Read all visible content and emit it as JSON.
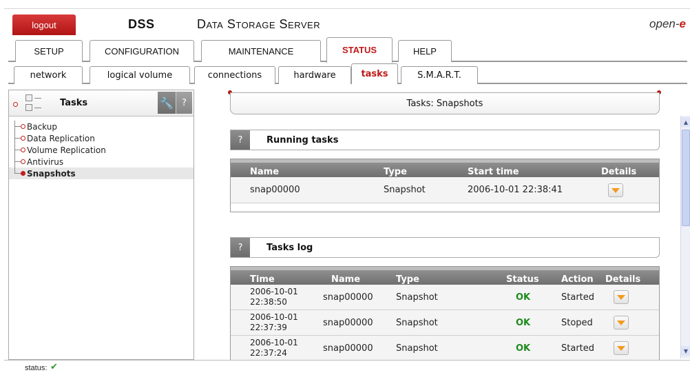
{
  "header": {
    "logout_label": "logout",
    "brand": "DSS",
    "product": "Data Storage Server",
    "vendor_prefix": "open-",
    "vendor_suffix": "e"
  },
  "main_tabs": [
    {
      "label": "SETUP"
    },
    {
      "label": "CONFIGURATION"
    },
    {
      "label": "MAINTENANCE"
    },
    {
      "label": "STATUS"
    },
    {
      "label": "HELP"
    }
  ],
  "sub_tabs": [
    {
      "label": "network"
    },
    {
      "label": "logical volume"
    },
    {
      "label": "connections"
    },
    {
      "label": "hardware"
    },
    {
      "label": "tasks"
    },
    {
      "label": "S.M.A.R.T."
    }
  ],
  "left_panel": {
    "title": "Tasks",
    "help_label": "?",
    "items": [
      {
        "label": "Backup"
      },
      {
        "label": "Data Replication"
      },
      {
        "label": "Volume Replication"
      },
      {
        "label": "Antivirus"
      },
      {
        "label": "Snapshots"
      }
    ]
  },
  "page_title": "Tasks: Snapshots",
  "running_tasks": {
    "title": "Running tasks",
    "help_label": "?",
    "headers": [
      "Name",
      "Type",
      "Start time",
      "Details"
    ],
    "rows": [
      {
        "name": "snap00000",
        "type": "Snapshot",
        "start_time": "2006-10-01 22:38:41"
      }
    ]
  },
  "tasks_log": {
    "title": "Tasks log",
    "help_label": "?",
    "headers": [
      "Time",
      "Name",
      "Type",
      "Status",
      "Action",
      "Details"
    ],
    "rows": [
      {
        "time_date": "2006-10-01",
        "time_clock": "22:38:50",
        "name": "snap00000",
        "type": "Snapshot",
        "status": "OK",
        "action": "Started"
      },
      {
        "time_date": "2006-10-01",
        "time_clock": "22:37:39",
        "name": "snap00000",
        "type": "Snapshot",
        "status": "OK",
        "action": "Stoped"
      },
      {
        "time_date": "2006-10-01",
        "time_clock": "22:37:24",
        "name": "snap00000",
        "type": "Snapshot",
        "status": "OK",
        "action": "Started"
      }
    ]
  },
  "statusbar": {
    "label": "status:",
    "icon": "check-icon"
  },
  "colors": {
    "accent_red": "#c41e1e",
    "ok_green": "#1c8a1c",
    "detail_arrow": "#f39a1e"
  }
}
